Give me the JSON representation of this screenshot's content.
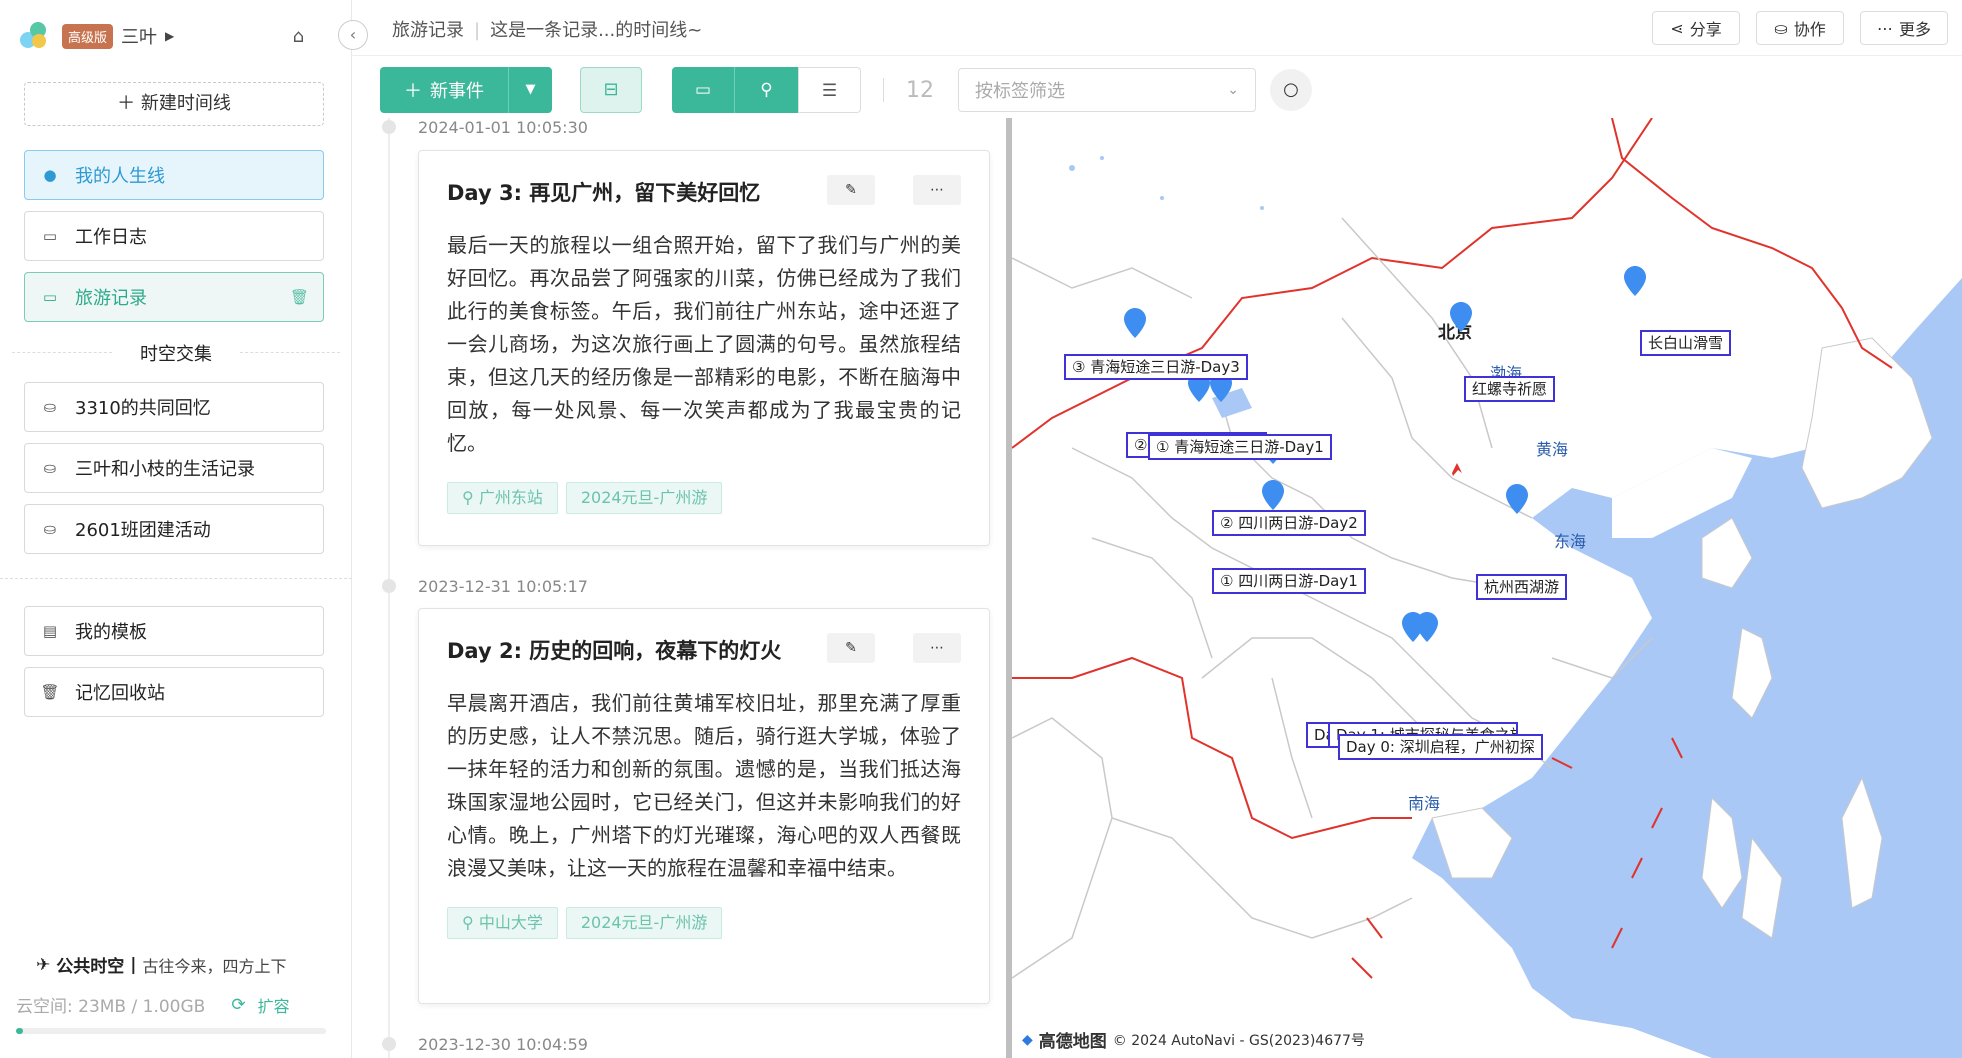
{
  "sidebar": {
    "badge": "高级版",
    "user_name": "三叶",
    "new_timeline": "新建时间线",
    "personal_items": [
      {
        "label": "我的人生线",
        "icon": "person-icon"
      },
      {
        "label": "工作日志",
        "icon": "book-icon"
      },
      {
        "label": "旅游记录",
        "icon": "book-icon"
      }
    ],
    "shared_section_title": "时空交集",
    "shared_items": [
      {
        "label": "3310的共同回忆",
        "icon": "group-icon"
      },
      {
        "label": "三叶和小枝的生活记录",
        "icon": "group-icon"
      },
      {
        "label": "2601班团建活动",
        "icon": "group-icon"
      }
    ],
    "util_items": [
      {
        "label": "我的模板",
        "icon": "template-icon"
      },
      {
        "label": "记忆回收站",
        "icon": "trash-icon"
      }
    ],
    "public_title": "公共时空",
    "public_sep": "|",
    "public_slogan": "古往今来，四方上下",
    "storage_text": "云空间: 23MB / 1.00GB",
    "expand_label": "扩容",
    "storage_fraction": 0.023
  },
  "header": {
    "breadcrumb_root": "旅游记录",
    "breadcrumb_desc": "这是一条记录...的时间线~",
    "share_label": "分享",
    "collab_label": "协作",
    "more_label": "更多"
  },
  "toolbar": {
    "new_event_label": "新事件",
    "event_count": "12",
    "tag_filter_placeholder": "按标签筛选"
  },
  "events": [
    {
      "time": "2024-01-01 10:05:30",
      "title": "Day 3: 再见广州，留下美好回忆",
      "body": "最后一天的旅程以一组合照开始，留下了我们与广州的美好回忆。再次品尝了阿强家的川菜，仿佛已经成为了我们此行的美食标签。午后，我们前往广州东站，途中还逛了一会儿商场，为这次旅行画上了圆满的句号。虽然旅程结束，但这几天的经历像是一部精彩的电影，不断在脑海中回放，每一处风景、每一次笑声都成为了我最宝贵的记忆。",
      "location": "广州东站",
      "tag": "2024元旦-广州游"
    },
    {
      "time": "2023-12-31 10:05:17",
      "title": "Day 2: 历史的回响，夜幕下的灯火",
      "body": "早晨离开酒店，我们前往黄埔军校旧址，那里充满了厚重的历史感，让人不禁沉思。随后，骑行逛大学城，体验了一抹年轻的活力和创新的氛围。遗憾的是，当我们抵达海珠国家湿地公园时，它已经关门，但这并未影响我们的好心情。晚上，广州塔下的灯光璀璨，海心吧的双人西餐既浪漫又美味，让这一天的旅程在温馨和幸福中结束。",
      "location": "中山大学",
      "tag": "2024元旦-广州游"
    },
    {
      "time": "2023-12-30 10:04:59"
    }
  ],
  "map": {
    "labels": [
      "③ 青海短途三日游-Day3",
      "②",
      "① 青海短途三日游-Day1",
      "② 四川两日游-Day2",
      "① 四川两日游-Day1",
      "红螺寺祈愿",
      "长白山滑雪",
      "杭州西湖游",
      "Da",
      "Day 1: 城市探秘与美食之旅",
      "Day 0: 深圳启程，广州初探"
    ],
    "cities": [
      "北京"
    ],
    "seas": [
      "渤海",
      "黄海",
      "东海",
      "南海"
    ],
    "brand": "高德地图",
    "copyright": "© 2024 AutoNavi - GS(2023)4677号",
    "colors": {
      "pin": "#3d8ef0",
      "label_border": "#3f32d6",
      "border_red": "#e0332c",
      "sea": "#a9c8f5",
      "land": "#ffffff"
    }
  }
}
